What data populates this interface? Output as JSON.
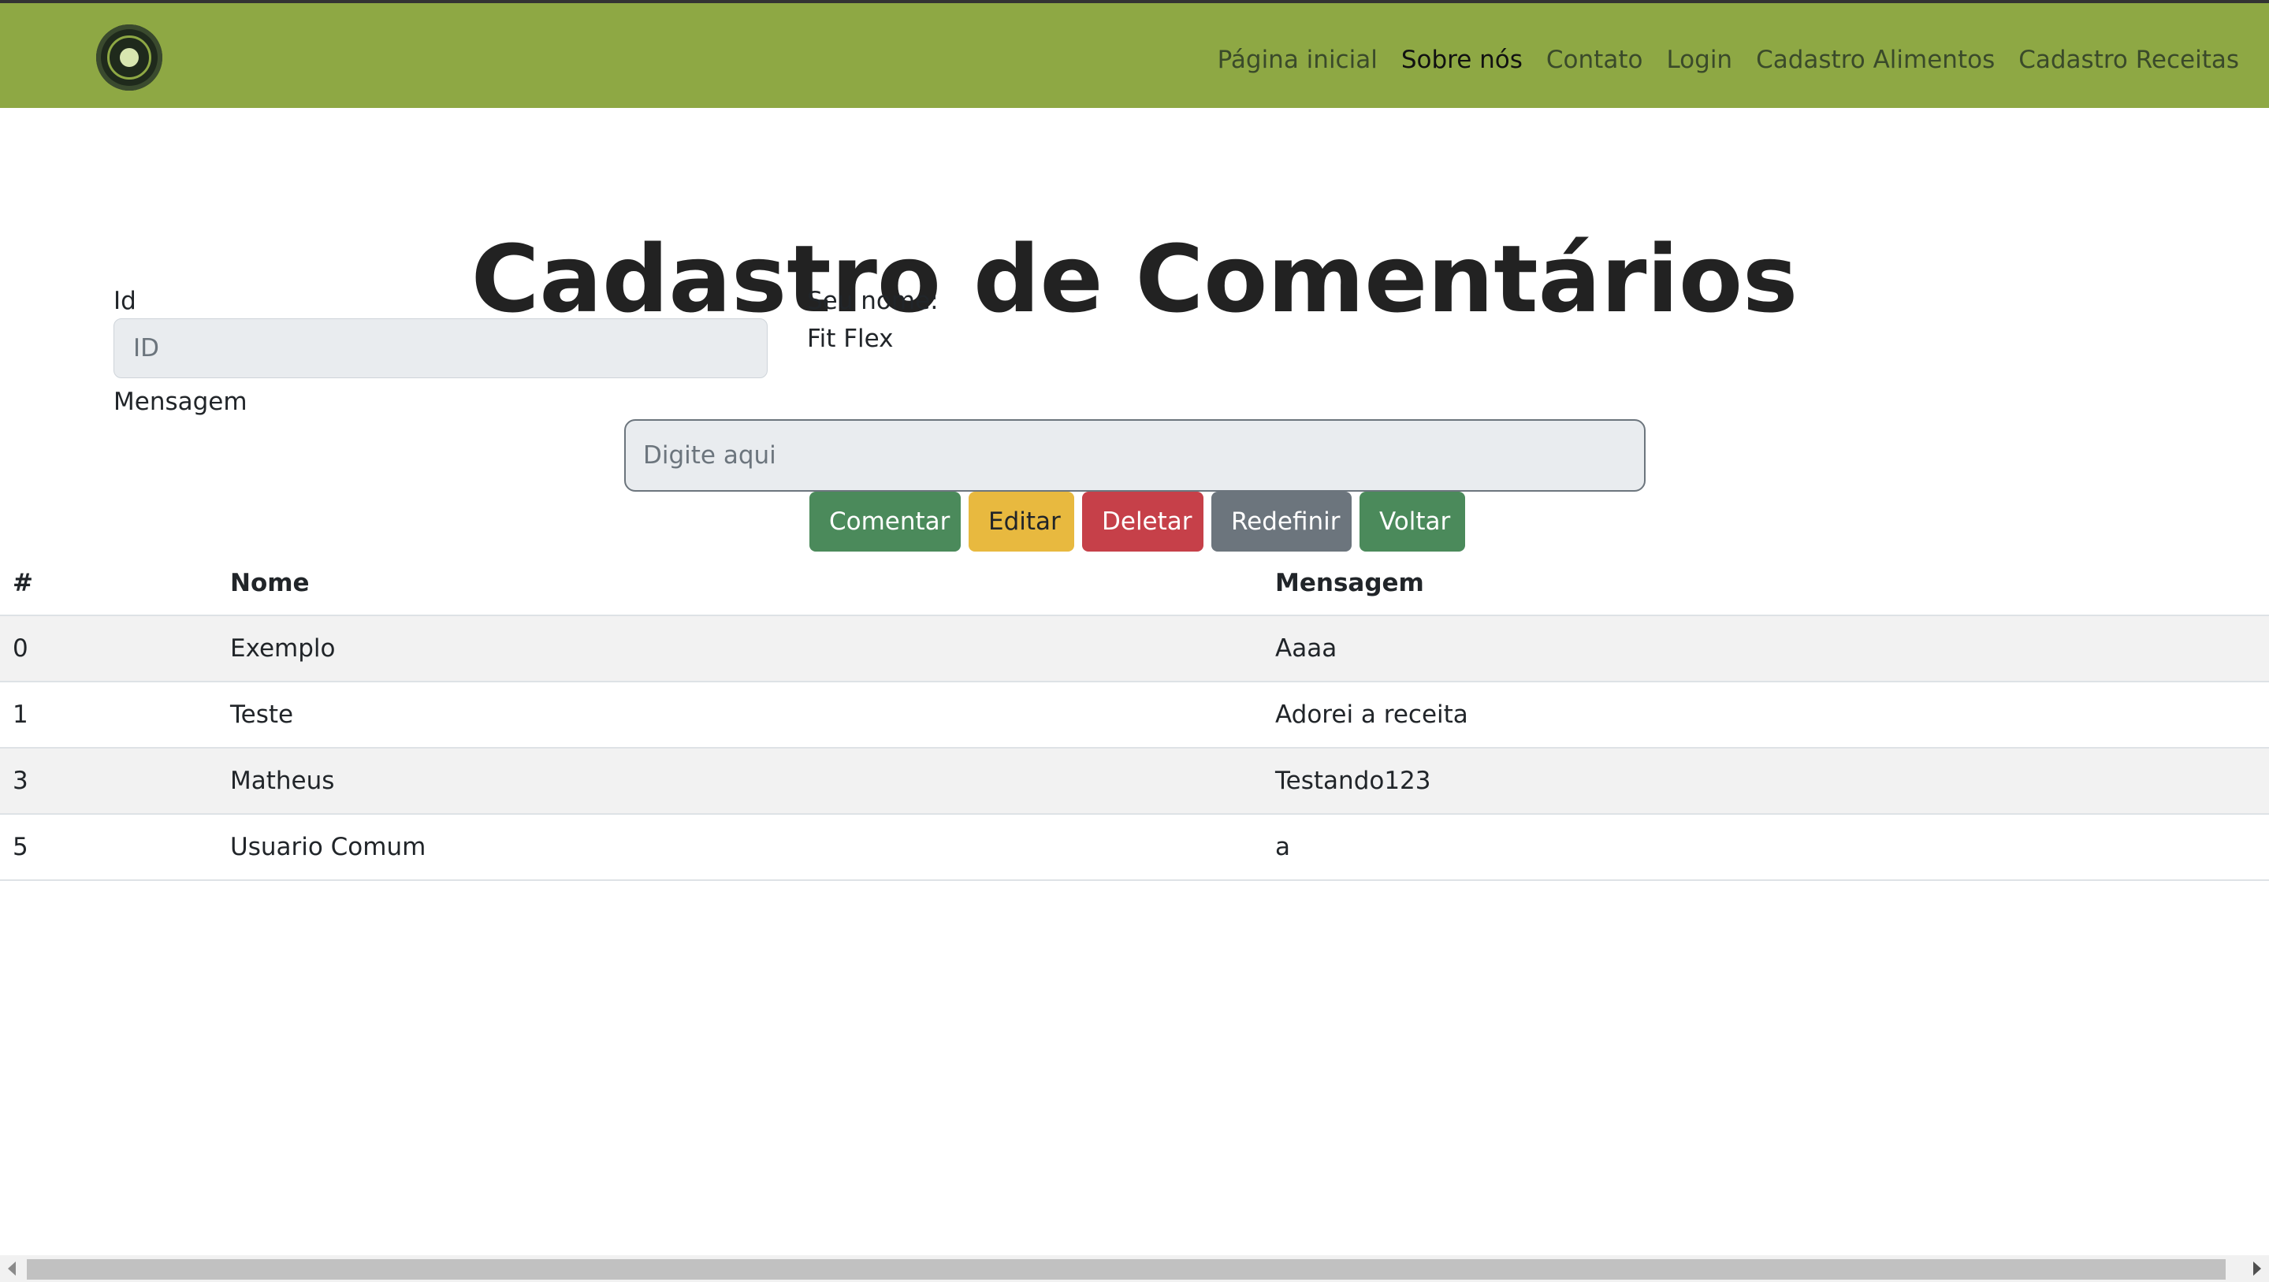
{
  "nav": {
    "links": [
      "Página inicial",
      "Sobre nós",
      "Contato",
      "Login",
      "Cadastro Alimentos",
      "Cadastro Receitas"
    ],
    "active": "Sobre nós"
  },
  "page_title": "Cadastro de Comentários",
  "form": {
    "id_label": "Id",
    "id_placeholder": "ID",
    "name_label": "Seu nome:",
    "name_value": "Fit Flex",
    "message_label": "Mensagem",
    "message_placeholder": "Digite aqui"
  },
  "buttons": {
    "comentar": "Comentar",
    "editar": "Editar",
    "deletar": "Deletar",
    "redefinir": "Redefinir",
    "voltar": "Voltar"
  },
  "table": {
    "headers": [
      "#",
      "Nome",
      "Mensagem"
    ],
    "rows": [
      [
        "0",
        "Exemplo",
        "Aaaa"
      ],
      [
        "1",
        "Teste",
        "Adorei a receita"
      ],
      [
        "3",
        "Matheus",
        "Testando123"
      ],
      [
        "5",
        "Usuario Comum",
        "a"
      ]
    ]
  },
  "colors": {
    "navbar": "#8ea844",
    "success": "#4b8a5b",
    "warning": "#e8b93f",
    "danger": "#c64049",
    "secondary": "#6c757d"
  },
  "icons": {
    "logo": "fit-flex-logo-icon",
    "scroll_left": "arrow-left-icon",
    "scroll_right": "arrow-right-icon"
  }
}
